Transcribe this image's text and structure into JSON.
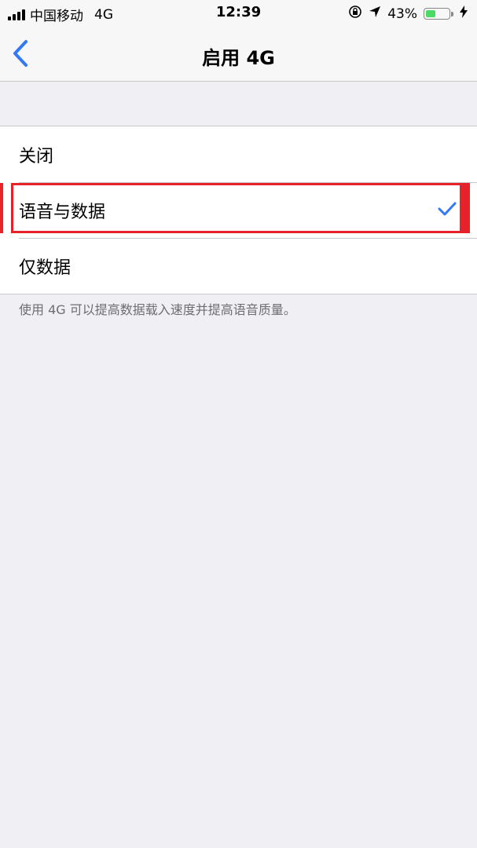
{
  "status_bar": {
    "carrier": "中国移动",
    "network": "4G",
    "time": "12:39",
    "battery_percent": "43%",
    "battery_level": 0.43
  },
  "nav": {
    "title": "启用 4G"
  },
  "options": [
    {
      "label": "关闭",
      "selected": false
    },
    {
      "label": "语音与数据",
      "selected": true
    },
    {
      "label": "仅数据",
      "selected": false
    }
  ],
  "footer": {
    "note": "使用 4G 可以提高数据载入速度并提高语音质量。"
  },
  "colors": {
    "accent": "#3478f6",
    "highlight": "#e8222a",
    "background": "#efeff4"
  }
}
